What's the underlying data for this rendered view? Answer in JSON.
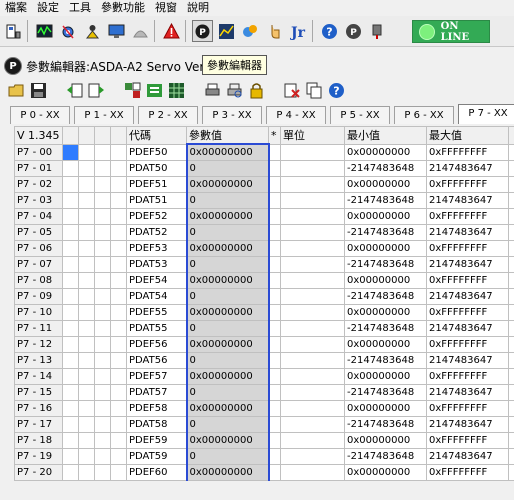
{
  "menu": [
    "檔案",
    "設定",
    "工具",
    "參數功能",
    "視窗",
    "說明"
  ],
  "toolbar_icons": [
    "connect-icon",
    "oscilloscope-icon",
    "settings-icon",
    "alarm-icon",
    "monitor-icon",
    "blank-icon",
    "warning-icon",
    "parameter-editor-icon",
    "chart-icon",
    "io-icon",
    "jog-icon",
    "tuning-icon",
    "help-icon",
    "info-icon",
    "tool-icon"
  ],
  "online_label": "ON LINE",
  "tooltip": "參數編輯器",
  "window_title": "參數編輯器:ASDA-A2 Servo Ver",
  "tabs": [
    "P 0 - XX",
    "P 1 - XX",
    "P 2 - XX",
    "P 3 - XX",
    "P 4 - XX",
    "P 5 - XX",
    "P 6 - XX",
    "P 7 - XX"
  ],
  "active_tab": 7,
  "grid": {
    "version": "V 1.345",
    "headers": [
      "代碼",
      "參數值",
      "*",
      "單位",
      "最小值",
      "最大值"
    ],
    "rows": [
      {
        "id": "P7 - 00",
        "code": "PDEF50",
        "value": "0x00000000",
        "min": "0x00000000",
        "max": "0xFFFFFFFF"
      },
      {
        "id": "P7 - 01",
        "code": "PDAT50",
        "value": "0",
        "min": "-2147483648",
        "max": "2147483647"
      },
      {
        "id": "P7 - 02",
        "code": "PDEF51",
        "value": "0x00000000",
        "min": "0x00000000",
        "max": "0xFFFFFFFF"
      },
      {
        "id": "P7 - 03",
        "code": "PDAT51",
        "value": "0",
        "min": "-2147483648",
        "max": "2147483647"
      },
      {
        "id": "P7 - 04",
        "code": "PDEF52",
        "value": "0x00000000",
        "min": "0x00000000",
        "max": "0xFFFFFFFF"
      },
      {
        "id": "P7 - 05",
        "code": "PDAT52",
        "value": "0",
        "min": "-2147483648",
        "max": "2147483647"
      },
      {
        "id": "P7 - 06",
        "code": "PDEF53",
        "value": "0x00000000",
        "min": "0x00000000",
        "max": "0xFFFFFFFF"
      },
      {
        "id": "P7 - 07",
        "code": "PDAT53",
        "value": "0",
        "min": "-2147483648",
        "max": "2147483647"
      },
      {
        "id": "P7 - 08",
        "code": "PDEF54",
        "value": "0x00000000",
        "min": "0x00000000",
        "max": "0xFFFFFFFF"
      },
      {
        "id": "P7 - 09",
        "code": "PDAT54",
        "value": "0",
        "min": "-2147483648",
        "max": "2147483647"
      },
      {
        "id": "P7 - 10",
        "code": "PDEF55",
        "value": "0x00000000",
        "min": "0x00000000",
        "max": "0xFFFFFFFF"
      },
      {
        "id": "P7 - 11",
        "code": "PDAT55",
        "value": "0",
        "min": "-2147483648",
        "max": "2147483647"
      },
      {
        "id": "P7 - 12",
        "code": "PDEF56",
        "value": "0x00000000",
        "min": "0x00000000",
        "max": "0xFFFFFFFF"
      },
      {
        "id": "P7 - 13",
        "code": "PDAT56",
        "value": "0",
        "min": "-2147483648",
        "max": "2147483647"
      },
      {
        "id": "P7 - 14",
        "code": "PDEF57",
        "value": "0x00000000",
        "min": "0x00000000",
        "max": "0xFFFFFFFF"
      },
      {
        "id": "P7 - 15",
        "code": "PDAT57",
        "value": "0",
        "min": "-2147483648",
        "max": "2147483647"
      },
      {
        "id": "P7 - 16",
        "code": "PDEF58",
        "value": "0x00000000",
        "min": "0x00000000",
        "max": "0xFFFFFFFF"
      },
      {
        "id": "P7 - 17",
        "code": "PDAT58",
        "value": "0",
        "min": "-2147483648",
        "max": "2147483647"
      },
      {
        "id": "P7 - 18",
        "code": "PDEF59",
        "value": "0x00000000",
        "min": "0x00000000",
        "max": "0xFFFFFFFF"
      },
      {
        "id": "P7 - 19",
        "code": "PDAT59",
        "value": "0",
        "min": "-2147483648",
        "max": "2147483647"
      },
      {
        "id": "P7 - 20",
        "code": "PDEF60",
        "value": "0x00000000",
        "min": "0x00000000",
        "max": "0xFFFFFFFF"
      }
    ]
  }
}
